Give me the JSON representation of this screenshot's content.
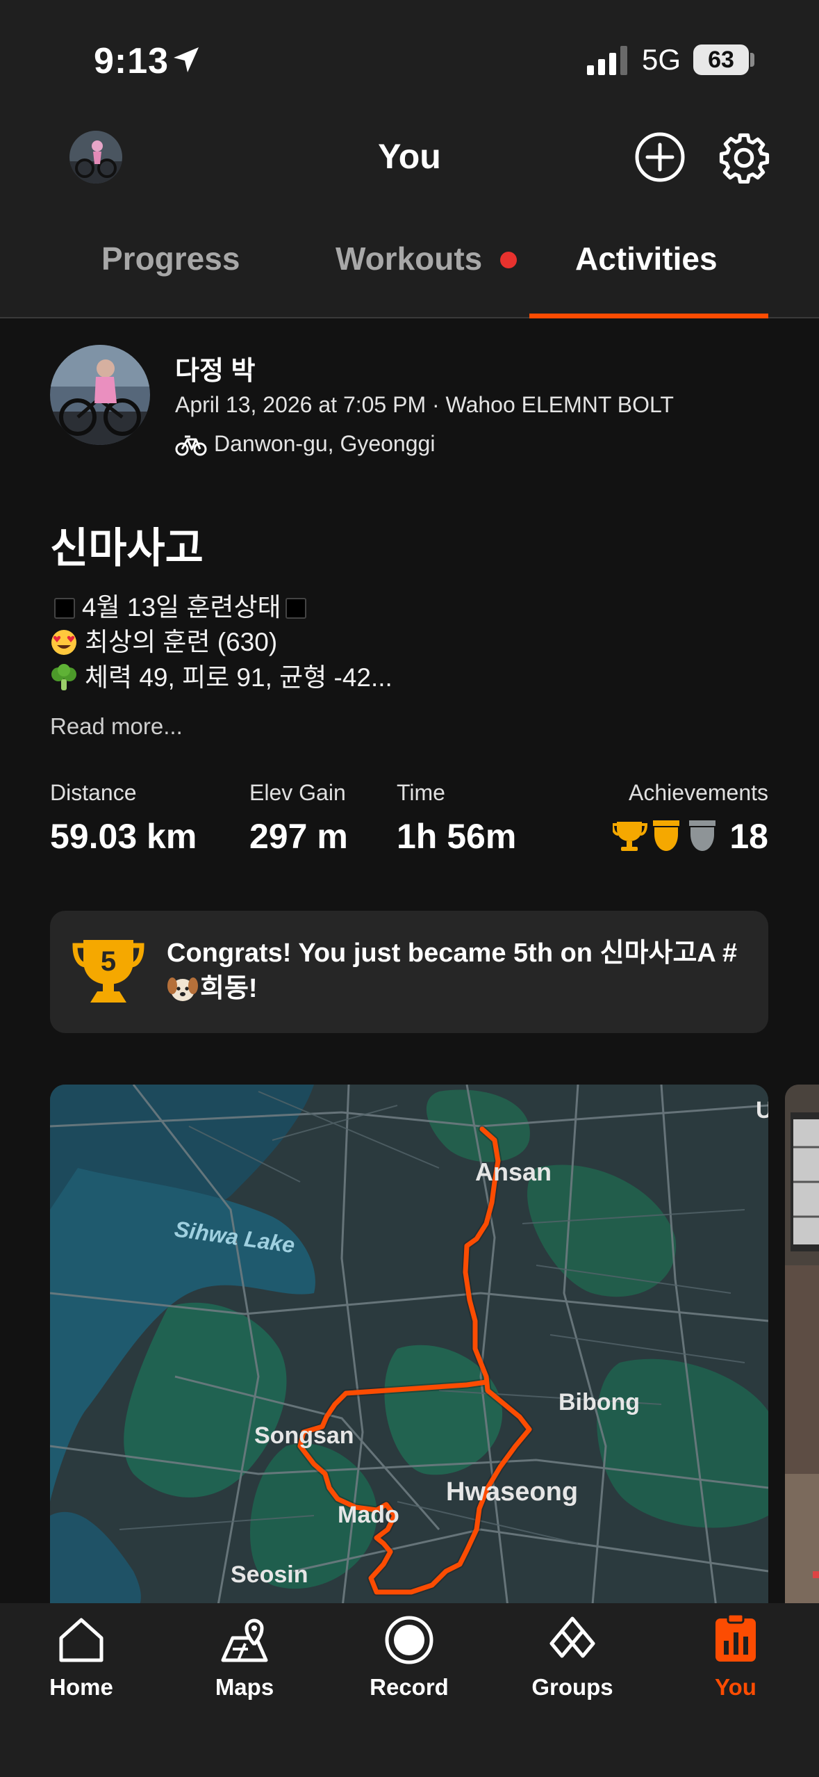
{
  "status_bar": {
    "time": "9:13",
    "network": "5G",
    "battery": "63"
  },
  "header": {
    "title": "You"
  },
  "tabs": [
    {
      "label": "Progress"
    },
    {
      "label": "Workouts",
      "has_badge": true
    },
    {
      "label": "Activities",
      "active": true
    }
  ],
  "activity": {
    "athlete_name": "다정 박",
    "meta": "April 13, 2026 at 7:05 PM · Wahoo ELEMNT BOLT",
    "location": "Danwon-gu, Gyeonggi",
    "title": "신마사고",
    "description": {
      "line1": "4월 13일 훈련상태",
      "line2": "최상의 훈련 (630)",
      "line3": "체력 49, 피로 91, 균형 -42..."
    },
    "read_more": "Read more...",
    "stats": {
      "distance_label": "Distance",
      "distance_value": "59.03 km",
      "elev_label": "Elev Gain",
      "elev_value": "297 m",
      "time_label": "Time",
      "time_value": "1h 56m",
      "achievements_label": "Achievements",
      "achievements_value": "18"
    },
    "congrats": {
      "rank": "5",
      "text_line1": "Congrats! You just became 5th on 신마사고A #",
      "text_line2": "희동!"
    }
  },
  "map": {
    "labels": {
      "ansan": "Ansan",
      "sihwa": "Sihwa Lake",
      "bibong": "Bibong",
      "songsan": "Songsan",
      "hwaseong": "Hwaseong",
      "mado": "Mado",
      "seosin": "Seosin",
      "edge": "U"
    },
    "route_color": "#fc4c02"
  },
  "bottom_nav": [
    {
      "label": "Home",
      "icon": "home-icon"
    },
    {
      "label": "Maps",
      "icon": "maps-icon"
    },
    {
      "label": "Record",
      "icon": "record-icon"
    },
    {
      "label": "Groups",
      "icon": "groups-icon"
    },
    {
      "label": "You",
      "icon": "you-icon",
      "active": true
    }
  ],
  "colors": {
    "accent": "#fc4c02",
    "badge": "#e8322e",
    "gold": "#f5a800",
    "silver": "#8e9497",
    "background": "#121212"
  }
}
